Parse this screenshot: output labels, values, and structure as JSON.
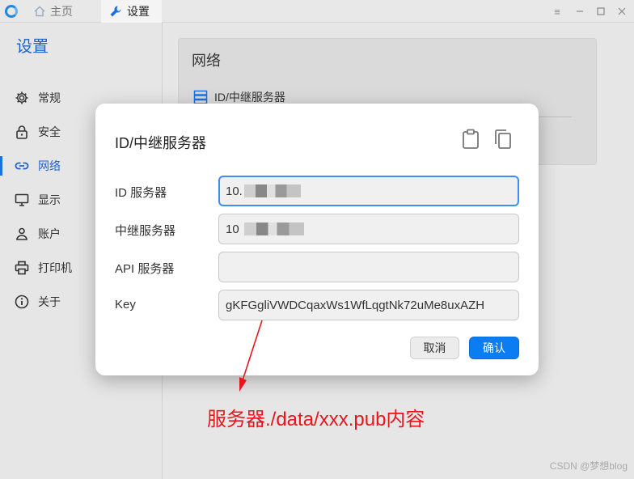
{
  "titlebar": {
    "tabs": [
      {
        "label": "主页",
        "icon": "home-icon"
      },
      {
        "label": "设置",
        "icon": "wrench-icon"
      }
    ],
    "controls": [
      "menu-icon",
      "minimize-icon",
      "maximize-icon",
      "close-icon"
    ]
  },
  "sidebar": {
    "title": "设置",
    "items": [
      {
        "label": "常规",
        "icon": "gear-icon"
      },
      {
        "label": "安全",
        "icon": "lock-icon"
      },
      {
        "label": "网络",
        "icon": "link-icon",
        "active": true
      },
      {
        "label": "显示",
        "icon": "monitor-icon"
      },
      {
        "label": "账户",
        "icon": "user-icon"
      },
      {
        "label": "打印机",
        "icon": "printer-icon"
      },
      {
        "label": "关于",
        "icon": "info-icon"
      }
    ]
  },
  "network": {
    "title": "网络",
    "row_label": "ID/中继服务器"
  },
  "dialog": {
    "title": "ID/中继服务器",
    "fields": [
      {
        "label": "ID 服务器",
        "value": "10."
      },
      {
        "label": "中继服务器",
        "value": "10"
      },
      {
        "label": "API 服务器",
        "value": ""
      },
      {
        "label": "Key",
        "value": "gKFGgliVWDCqaxWs1WfLqgtNk72uMe8uxAZH"
      }
    ],
    "cancel_label": "取消",
    "ok_label": "确认"
  },
  "annotation": "服务器./data/xxx.pub内容",
  "watermark": "CSDN @梦想blog",
  "colors": {
    "accent": "#1e6fe0",
    "annotation": "#e8161c"
  }
}
